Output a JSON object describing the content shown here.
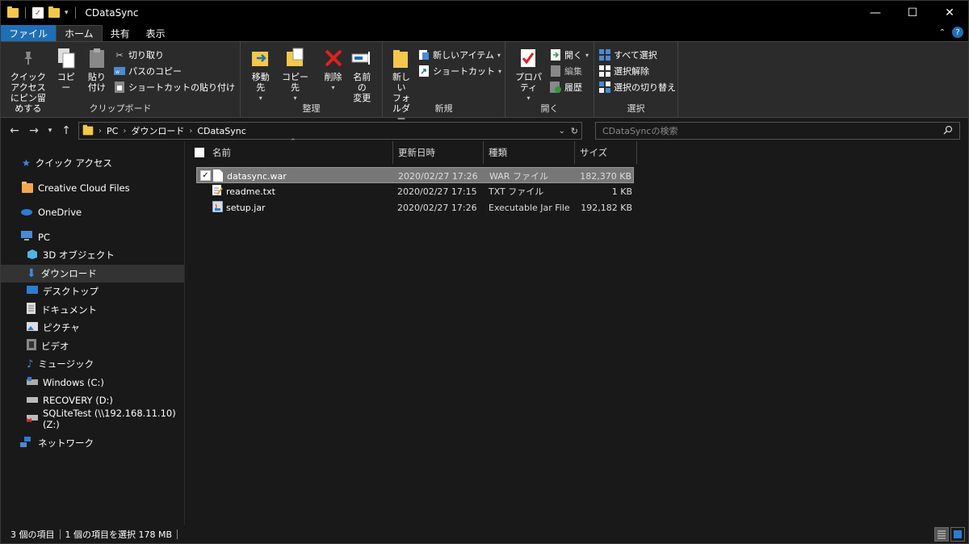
{
  "window": {
    "title": "CDataSync",
    "controls": {
      "minimize": "—",
      "maximize": "☐",
      "close": "✕"
    }
  },
  "tabs": [
    {
      "label": "ファイル"
    },
    {
      "label": "ホーム"
    },
    {
      "label": "共有"
    },
    {
      "label": "表示"
    }
  ],
  "ribbon": {
    "clipboard": {
      "title": "クリップボード",
      "pin": "クイック アクセス\nにピン留めする",
      "copy": "コピー",
      "paste": "貼り付け",
      "cut": "切り取り",
      "copy_path": "パスのコピー",
      "paste_shortcut": "ショートカットの貼り付け"
    },
    "organize": {
      "title": "整理",
      "move_to": "移動先",
      "copy_to": "コピー先",
      "delete": "削除",
      "rename": "名前の\n変更"
    },
    "new": {
      "title": "新規",
      "new_folder": "新しい\nフォルダー",
      "new_item": "新しいアイテム",
      "shortcut": "ショートカット"
    },
    "open": {
      "title": "開く",
      "properties": "プロパティ",
      "open": "開く",
      "edit": "編集",
      "history": "履歴"
    },
    "select": {
      "title": "選択",
      "select_all": "すべて選択",
      "select_none": "選択解除",
      "invert": "選択の切り替え"
    }
  },
  "address": {
    "path": [
      "PC",
      "ダウンロード",
      "CDataSync"
    ],
    "search_placeholder": "CDataSyncの検索"
  },
  "nav": {
    "quick_access": "クイック アクセス",
    "creative_cloud": "Creative Cloud Files",
    "onedrive": "OneDrive",
    "pc": "PC",
    "items": [
      {
        "label": "3D オブジェクト"
      },
      {
        "label": "ダウンロード"
      },
      {
        "label": "デスクトップ"
      },
      {
        "label": "ドキュメント"
      },
      {
        "label": "ピクチャ"
      },
      {
        "label": "ビデオ"
      },
      {
        "label": "ミュージック"
      },
      {
        "label": "Windows (C:)"
      },
      {
        "label": "RECOVERY (D:)"
      },
      {
        "label": "SQLiteTest (\\\\192.168.11.10) (Z:)"
      }
    ],
    "network": "ネットワーク"
  },
  "columns": {
    "name": "名前",
    "date": "更新日時",
    "type": "種類",
    "size": "サイズ"
  },
  "files": [
    {
      "name": "datasync.war",
      "date": "2020/02/27 17:26",
      "type": "WAR ファイル",
      "size": "182,370 KB"
    },
    {
      "name": "readme.txt",
      "date": "2020/02/27 17:15",
      "type": "TXT ファイル",
      "size": "1 KB"
    },
    {
      "name": "setup.jar",
      "date": "2020/02/27 17:26",
      "type": "Executable Jar File",
      "size": "192,182 KB"
    }
  ],
  "status": {
    "count": "3 個の項目",
    "selection": "1 個の項目を選択 178 MB"
  },
  "colors": {
    "file_tab": "#1f6fb5",
    "folder": "#f3c84b",
    "selected_row": "#777777"
  }
}
